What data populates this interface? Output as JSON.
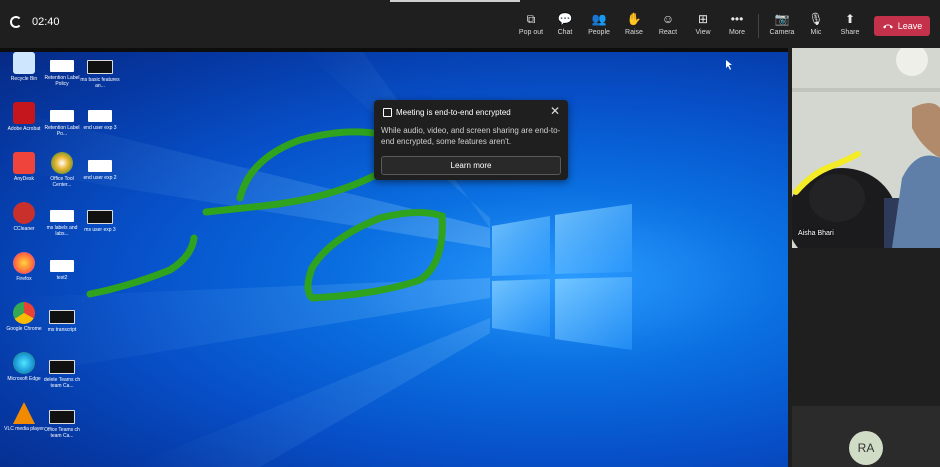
{
  "topbar": {
    "timer": "02:40",
    "buttons": [
      {
        "name": "pop-out-button",
        "label": "Pop out",
        "icon": "⧉"
      },
      {
        "name": "chat-button",
        "label": "Chat",
        "icon": "💬"
      },
      {
        "name": "people-button",
        "label": "People",
        "icon": "👥"
      },
      {
        "name": "raise-button",
        "label": "Raise",
        "icon": "✋"
      },
      {
        "name": "react-button",
        "label": "React",
        "icon": "☺"
      },
      {
        "name": "view-button",
        "label": "View",
        "icon": "⊞"
      },
      {
        "name": "more-button",
        "label": "More",
        "icon": "•••"
      },
      {
        "name": "camera-button",
        "label": "Camera",
        "icon": "📷"
      },
      {
        "name": "mic-button",
        "label": "Mic",
        "icon": "🎙"
      },
      {
        "name": "share-button",
        "label": "Share",
        "icon": "⬆"
      }
    ],
    "leave_label": "Leave",
    "leave_color": "#c4314b"
  },
  "toast": {
    "title": "Meeting is end-to-end encrypted",
    "body": "While audio, video, and screen sharing are end-to-end encrypted, some features aren't.",
    "button": "Learn more"
  },
  "video": {
    "participant": "Aisha Bhari"
  },
  "avatar": {
    "initials": "RA"
  },
  "desktop_icons": [
    {
      "label": "Recycle Bin",
      "kind": "recycle",
      "color": "#cfe6ff"
    },
    {
      "label": "Adobe Acrobat",
      "kind": "app",
      "color": "#c4161c"
    },
    {
      "label": "AnyDesk",
      "kind": "app",
      "color": "#ef443b"
    },
    {
      "label": "CCleaner",
      "kind": "app",
      "color": "#c9302c"
    },
    {
      "label": "Firefox",
      "kind": "app",
      "color": "#ff7139"
    },
    {
      "label": "Google Chrome",
      "kind": "app",
      "color": "#4285f4"
    },
    {
      "label": "Microsoft Edge",
      "kind": "app",
      "color": "#1d9bd8"
    },
    {
      "label": "VLC media player",
      "kind": "app",
      "color": "#f28a00"
    },
    {
      "label": "Retention Label Policy",
      "kind": "thumb"
    },
    {
      "label": "Retention Label Po...",
      "kind": "thumb"
    },
    {
      "label": "Office Tool Center...",
      "kind": "app",
      "color": "#e8b531"
    },
    {
      "label": "ms labels and labs...",
      "kind": "thumb"
    },
    {
      "label": "test2",
      "kind": "thumb"
    },
    {
      "label": "ms transcript",
      "kind": "thumb-dark"
    },
    {
      "label": "delete Teams ch team Ca...",
      "kind": "thumb-dark"
    },
    {
      "label": "Office Teams ch team Ca...",
      "kind": "thumb-dark"
    },
    {
      "label": "ms basic features an...",
      "kind": "thumb-dark"
    },
    {
      "label": "end user exp 3",
      "kind": "thumb"
    },
    {
      "label": "end user exp 2",
      "kind": "thumb"
    },
    {
      "label": "ms user exp 3",
      "kind": "thumb-dark"
    }
  ]
}
